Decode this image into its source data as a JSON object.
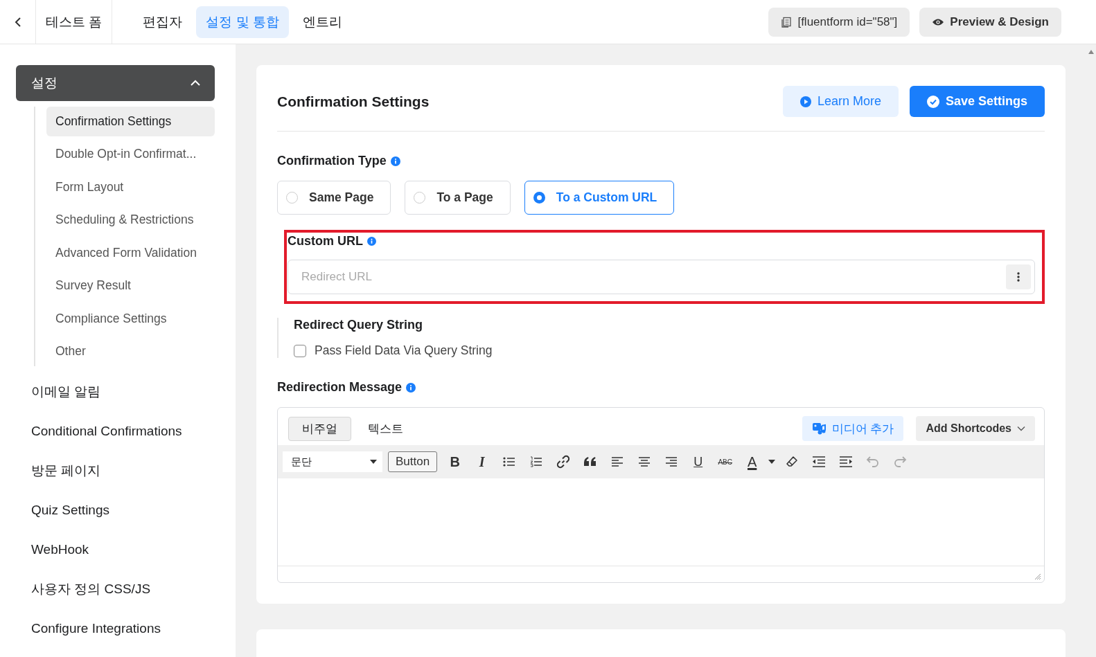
{
  "topbar": {
    "form_name": "테스트 폼",
    "tabs": [
      {
        "label": "편집자",
        "selected": false
      },
      {
        "label": "설정 및 통합",
        "selected": true
      },
      {
        "label": "엔트리",
        "selected": false
      }
    ],
    "shortcode": "[fluentform id=\"58\"]",
    "preview_button": "Preview & Design"
  },
  "sidebar": [
    {
      "label": "설정",
      "expanded": true,
      "children": [
        {
          "label": "Confirmation Settings",
          "selected": true
        },
        {
          "label": "Double Opt-in Confirmat...",
          "selected": false
        },
        {
          "label": "Form Layout",
          "selected": false
        },
        {
          "label": "Scheduling & Restrictions",
          "selected": false
        },
        {
          "label": "Advanced Form Validation",
          "selected": false
        },
        {
          "label": "Survey Result",
          "selected": false
        },
        {
          "label": "Compliance Settings",
          "selected": false
        },
        {
          "label": "Other",
          "selected": false
        }
      ]
    },
    {
      "label": "이메일 알림",
      "selected": false
    },
    {
      "label": "Conditional Confirmations",
      "selected": false
    },
    {
      "label": "방문 페이지",
      "selected": false
    },
    {
      "label": "Quiz Settings",
      "selected": false
    },
    {
      "label": "WebHook",
      "selected": false
    },
    {
      "label": "사용자 정의 CSS/JS",
      "selected": false
    },
    {
      "label": "Configure Integrations",
      "selected": false
    }
  ],
  "card": {
    "title": "Confirmation Settings",
    "learn_more": "Learn More",
    "save": "Save Settings",
    "confirmation_type": {
      "label": "Confirmation Type",
      "options": [
        {
          "label": "Same Page",
          "selected": false
        },
        {
          "label": "To a Page",
          "selected": false
        },
        {
          "label": "To a Custom URL",
          "selected": true
        }
      ]
    },
    "custom_url": {
      "label": "Custom URL",
      "placeholder": "Redirect URL",
      "highlighted": true
    },
    "query_string": {
      "label": "Redirect Query String",
      "checkbox": {
        "label": "Pass Field Data Via Query String",
        "checked": false
      }
    },
    "redirection_message": {
      "label": "Redirection Message",
      "editor": {
        "tabs": [
          {
            "label": "비주얼",
            "selected": true
          },
          {
            "label": "텍스트",
            "selected": false
          }
        ],
        "media_button": "미디어 추가",
        "shortcodes_button": "Add Shortcodes",
        "format": "문단",
        "button_label": "Button",
        "glyphs": {
          "bold": "B",
          "italic": "I",
          "underline": "U",
          "strikethrough": "ABC",
          "text_color": "A"
        },
        "undo": {
          "disabled": true
        },
        "redo": {
          "disabled": true
        }
      }
    }
  }
}
